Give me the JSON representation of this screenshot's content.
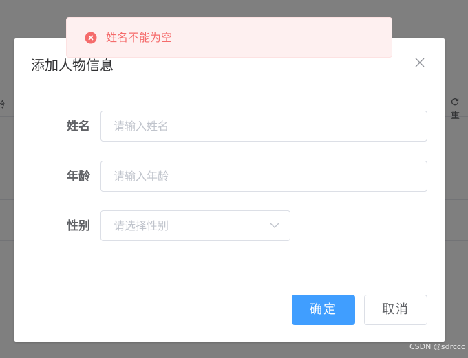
{
  "background": {
    "left_fragment": "龄",
    "right_fragment": "重"
  },
  "dialog": {
    "title": "添加人物信息",
    "close_icon": "close-icon",
    "fields": [
      {
        "label": "姓名",
        "placeholder": "请输入姓名",
        "value": ""
      },
      {
        "label": "年龄",
        "placeholder": "请输入年龄",
        "value": ""
      },
      {
        "label": "性别",
        "placeholder": "请选择性别",
        "selected": ""
      }
    ],
    "confirm_label": "确定",
    "cancel_label": "取消"
  },
  "message": {
    "type": "error",
    "icon": "error-circle-icon",
    "text": "姓名不能为空",
    "color": "#f56c6c"
  },
  "watermark": "CSDN @sdrccc",
  "colors": {
    "primary": "#409eff",
    "error": "#f56c6c"
  }
}
